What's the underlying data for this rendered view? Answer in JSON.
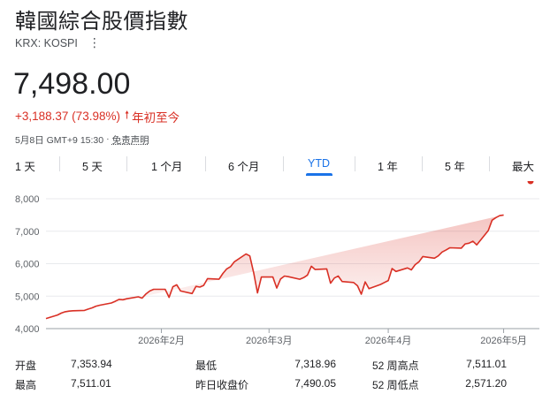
{
  "header": {
    "title": "韓國綜合股價指數",
    "ticker": "KRX: KOSPI",
    "more_icon": "more-vert-icon"
  },
  "quote": {
    "price": "7,498.00",
    "change": "+3,188.37 (73.98%)",
    "direction_icon": "arrow-up-icon",
    "period": "年初至今",
    "timestamp": "5月8日 GMT+9 15:30",
    "separator": "·",
    "disclaimer": "免责声明",
    "color_up": "#d93025"
  },
  "range_tabs": [
    {
      "label": "1 天"
    },
    {
      "label": "5 天"
    },
    {
      "label": "1 个月"
    },
    {
      "label": "6 个月"
    },
    {
      "label": "YTD",
      "active": true
    },
    {
      "label": "1 年"
    },
    {
      "label": "5 年"
    },
    {
      "label": "最大"
    }
  ],
  "chart_data": {
    "type": "area",
    "title": "",
    "xlabel": "",
    "ylabel": "",
    "ylim": [
      4000,
      8000
    ],
    "yticks": [
      "4,000",
      "5,000",
      "6,000",
      "7,000",
      "8,000"
    ],
    "xticks": [
      {
        "label": "2026年2月",
        "day": 32
      },
      {
        "label": "2026年3月",
        "day": 60
      },
      {
        "label": "2026年4月",
        "day": 91
      },
      {
        "label": "2026年5月",
        "day": 121
      }
    ],
    "grid": true,
    "color": "#d93025",
    "x_days": [
      2,
      5,
      6,
      7,
      8,
      9,
      12,
      13,
      14,
      15,
      16,
      19,
      20,
      21,
      22,
      23,
      26,
      27,
      28,
      29,
      30,
      33,
      34,
      35,
      36,
      37,
      40,
      41,
      42,
      43,
      44,
      47,
      48,
      49,
      50,
      51,
      54,
      55,
      56,
      57,
      58,
      61,
      62,
      63,
      64,
      65,
      68,
      69,
      70,
      71,
      72,
      75,
      76,
      77,
      78,
      79,
      82,
      83,
      84,
      85,
      86,
      89,
      90,
      91,
      92,
      93,
      96,
      97,
      98,
      99,
      100,
      103,
      104,
      105,
      106,
      107,
      110,
      111,
      112,
      113,
      114,
      117,
      118,
      119,
      120,
      121,
      124,
      125,
      126,
      127,
      128
    ],
    "values": [
      4310,
      4420,
      4480,
      4520,
      4540,
      4550,
      4560,
      4600,
      4640,
      4690,
      4720,
      4790,
      4840,
      4900,
      4890,
      4920,
      4980,
      4940,
      5070,
      5160,
      5210,
      5210,
      4960,
      5290,
      5350,
      5160,
      5080,
      5300,
      5280,
      5330,
      5540,
      5520,
      5700,
      5840,
      5910,
      6060,
      6300,
      6240,
      5720,
      5100,
      5590,
      5590,
      5250,
      5530,
      5620,
      5600,
      5520,
      5570,
      5650,
      5920,
      5820,
      5840,
      5400,
      5560,
      5620,
      5450,
      5420,
      5320,
      5060,
      5440,
      5230,
      5360,
      5420,
      5480,
      5850,
      5760,
      5870,
      5810,
      5970,
      6060,
      6220,
      6170,
      6240,
      6360,
      6420,
      6490,
      6480,
      6610,
      6630,
      6690,
      6580,
      7020,
      7340,
      7420,
      7480,
      7498
    ]
  },
  "stats": {
    "open_label": "开盘",
    "open": "7,353.94",
    "low_label": "最低",
    "low": "7,318.96",
    "high52_label": "52 周高点",
    "high52": "7,511.01",
    "high_label": "最高",
    "high": "7,511.01",
    "prev_close_label": "昨日收盘价",
    "prev_close": "7,490.05",
    "low52_label": "52 周低点",
    "low52": "2,571.20"
  }
}
